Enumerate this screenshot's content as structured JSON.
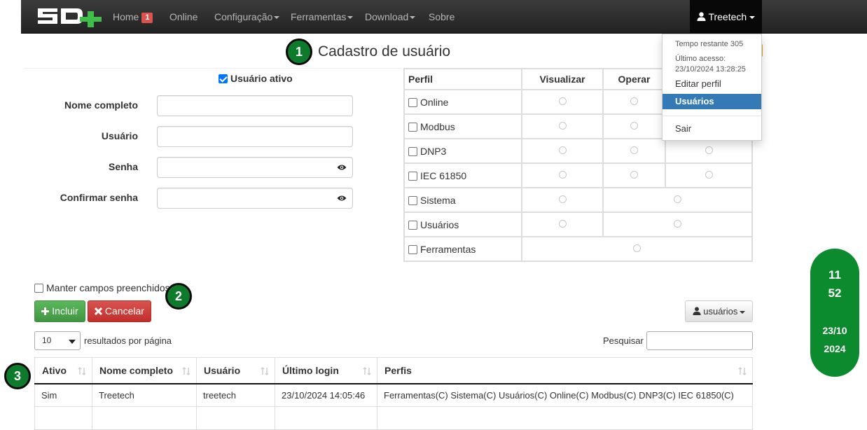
{
  "nav": {
    "home": "Home",
    "home_badge": "1",
    "online": "Online",
    "config": "Configuração",
    "tools": "Ferramentas",
    "download": "Download",
    "about": "Sobre",
    "user": "Treetech",
    "logo_icon": "sd-plus-logo"
  },
  "dropdown": {
    "remaining": "Tempo restante 305",
    "last_access_label": "Último acesso:",
    "last_access_value": "23/10/2024 13:28:25",
    "edit_profile": "Editar perfil",
    "users": "Usuários",
    "logout": "Sair"
  },
  "steps": [
    "1",
    "2",
    "3"
  ],
  "page_title": "Cadastro de usuário",
  "form": {
    "active_label": "Usuário ativo",
    "active_checked": true,
    "full_name_label": "Nome completo",
    "username_label": "Usuário",
    "password_label": "Senha",
    "confirm_label": "Confirmar senha",
    "full_name_value": "",
    "username_value": "",
    "password_value": "",
    "confirm_value": ""
  },
  "profiles": {
    "headers": [
      "Perfil",
      "Visualizar",
      "Operar",
      ""
    ],
    "rows": [
      "Online",
      "Modbus",
      "DNP3",
      "IEC 61850",
      "Sistema",
      "Usuários",
      "Ferramentas"
    ]
  },
  "keep_fields": "Manter campos preenchidos",
  "buttons": {
    "include": "Incluir",
    "cancel": "Cancelar",
    "users_menu": "usuários"
  },
  "list": {
    "page_size": "10",
    "page_size_label": "resultados por página",
    "search_label": "Pesquisar",
    "columns": [
      "Ativo",
      "Nome completo",
      "Usuário",
      "Último login",
      "Perfis"
    ],
    "rows": [
      [
        "Sim",
        "Treetech",
        "treetech",
        "23/10/2024 14:05:46",
        "Ferramentas(C) Sistema(C) Usuários(C) Online(C) Modbus(C) DNP3(C) IEC 61850(C)"
      ]
    ]
  },
  "clock": {
    "hour": "11",
    "minute": "52",
    "date": "23/10",
    "year": "2024"
  },
  "colors": {
    "navbar": "#222222",
    "accent_blue": "#337ab7",
    "green": "#0c8a2e",
    "danger": "#d9534f"
  }
}
